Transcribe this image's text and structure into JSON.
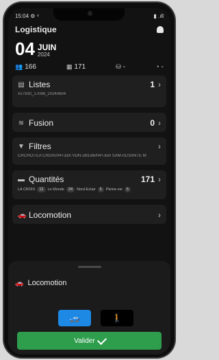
{
  "status_bar": {
    "time": "15:04",
    "extra": "⚙ ⁴",
    "right": "▮ .ıll"
  },
  "header": {
    "app_title": "Logistique",
    "day": "04",
    "month": "JUIN",
    "year": "2024"
  },
  "stats": [
    {
      "icon": "people-icon",
      "glyph": "👥",
      "value": "166"
    },
    {
      "icon": "grid-icon",
      "glyph": "▦",
      "value": "171"
    },
    {
      "icon": "binoculars-icon",
      "glyph": "⛁",
      "value": "-"
    },
    {
      "icon": "clock-icon",
      "glyph": "◔",
      "value": "-"
    }
  ],
  "cards": {
    "listes": {
      "label": "Listes",
      "count": "1",
      "sub": "#27930_17088_20240604"
    },
    "fusion": {
      "label": "Fusion",
      "count": "0"
    },
    "filtres": {
      "label": "Filtres",
      "sub": "CRCHOT/LA CROIX/04+Juin    VDN-28/Lille/04+Juin    SAM-01/SANTE M"
    },
    "quantites": {
      "label": "Quantités",
      "count": "171",
      "chips": [
        {
          "label": "LA CROIX",
          "value": "12"
        },
        {
          "label": "Le Monde",
          "value": "24"
        },
        {
          "label": "Nord-Eclair",
          "value": "5"
        },
        {
          "label": "Pleine-vie",
          "value": "5"
        }
      ]
    },
    "locomotion": {
      "label": "Locomotion"
    }
  },
  "sheet": {
    "title": "Locomotion",
    "modes": [
      {
        "icon": "car-icon",
        "glyph": "🚙",
        "active": true
      },
      {
        "icon": "walk-icon",
        "glyph": "🚶",
        "active": false
      }
    ],
    "validate_label": "Valider"
  }
}
